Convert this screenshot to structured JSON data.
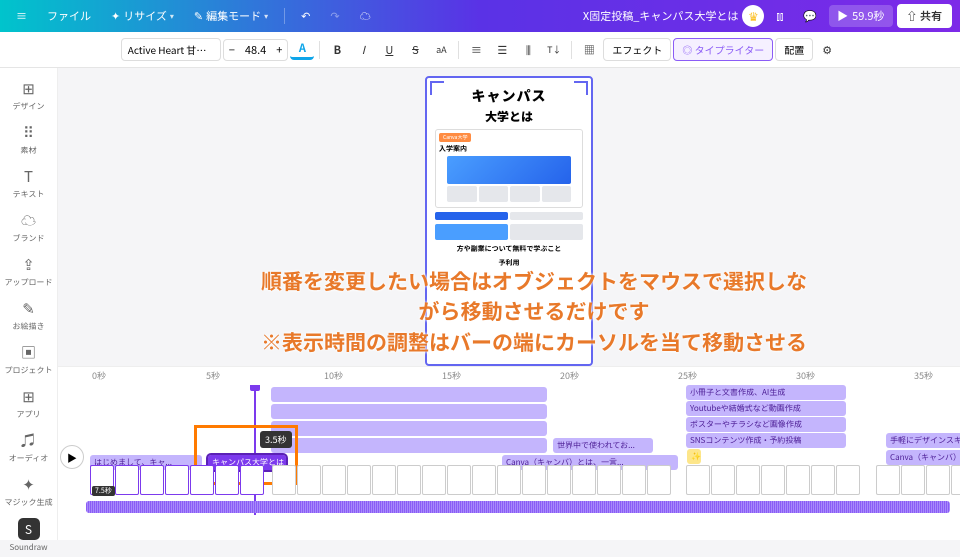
{
  "topbar": {
    "file": "ファイル",
    "resize": "リサイズ",
    "edit_mode": "編集モード",
    "doc_title": "X固定投稿_キャンパス大学とは",
    "play_time": "59.9秒",
    "share": "共有"
  },
  "toolbar": {
    "font_name": "Active Heart 甘い...",
    "font_size": "48.4",
    "effect": "エフェクト",
    "typewriter": "タイプライター",
    "position": "配置"
  },
  "sidebar": {
    "items": [
      {
        "icon": "⊞",
        "label": "デザイン"
      },
      {
        "icon": "⠿",
        "label": "素材"
      },
      {
        "icon": "T",
        "label": "テキスト"
      },
      {
        "icon": "☁",
        "label": "ブランド"
      },
      {
        "icon": "⇪",
        "label": "アップロード"
      },
      {
        "icon": "✎",
        "label": "お絵描き"
      },
      {
        "icon": "▣",
        "label": "プロジェクト"
      },
      {
        "icon": "⊞",
        "label": "アプリ"
      },
      {
        "icon": "♫",
        "label": "オーディオ"
      },
      {
        "icon": "✦",
        "label": "マジック生成"
      },
      {
        "icon": "S",
        "label": "Soundraw"
      }
    ]
  },
  "preview": {
    "title_line1": "キャンパス",
    "title_line2": "大学とは",
    "card_tag": "Canva大学",
    "card_body": "入学案内",
    "body_text1": "方や副業について無料で学ぶこと",
    "body_text2": "予利用"
  },
  "overlay": {
    "line1": "順番を変更したい場合はオブジェクトをマウスで選択しな",
    "line2": "がら移動させるだけです",
    "line3": "※表示時間の調整はバーの端にカーソルを当て移動させる"
  },
  "timeline": {
    "ticks": [
      "0秒",
      "5秒",
      "10秒",
      "15秒",
      "20秒",
      "25秒",
      "30秒",
      "35秒"
    ],
    "tooltip": "3.5秒",
    "thumb_label": "7.5秒",
    "bars": {
      "b1": "はじめまして、キャ...",
      "b2": "キャンパス大学とは",
      "b3": "世界中で使われてお...",
      "b4": "Canva（キャンバ）とは、一言...",
      "b5": "小冊子と文書作成、AI生成",
      "b6": "Youtubeや結婚式など動画作成",
      "b7": "ポスターやチラシなど画像作成",
      "b8": "SNSコンテンツ作成・予約投稿",
      "b9": "手軽にデザインスキルを...",
      "b10": "Canva（キャンバ）のスキルを..."
    }
  }
}
